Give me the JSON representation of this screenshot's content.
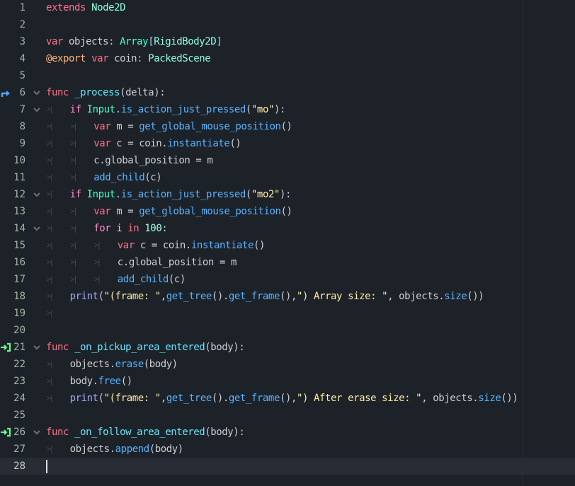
{
  "editor": {
    "current_line": 28,
    "colors": {
      "background": "#1d2229",
      "current_line": "#272c35",
      "keyword": "#ff7085",
      "type": "#42ffc2",
      "string": "#ffeda1"
    },
    "lines": [
      {
        "n": "1",
        "indent": 0,
        "tokens": [
          [
            "extends",
            "kw"
          ],
          [
            " ",
            "txt"
          ],
          [
            "Node2D",
            "type2"
          ]
        ]
      },
      {
        "n": "2",
        "indent": 0,
        "tokens": []
      },
      {
        "n": "3",
        "indent": 0,
        "tokens": [
          [
            "var",
            "kw"
          ],
          [
            " objects",
            "txt"
          ],
          [
            ": ",
            "sym"
          ],
          [
            "Array",
            "type"
          ],
          [
            "[",
            "sym"
          ],
          [
            "RigidBody2D",
            "type2"
          ],
          [
            "]",
            "sym"
          ]
        ]
      },
      {
        "n": "4",
        "indent": 0,
        "tokens": [
          [
            "@export",
            "ann"
          ],
          [
            " ",
            "txt"
          ],
          [
            "var",
            "kw"
          ],
          [
            " coin",
            "txt"
          ],
          [
            ": ",
            "sym"
          ],
          [
            "PackedScene",
            "type2"
          ]
        ]
      },
      {
        "n": "5",
        "indent": 0,
        "tokens": []
      },
      {
        "n": "6",
        "indent": 0,
        "fold": true,
        "gutter": "override-icon",
        "tokens": [
          [
            "func",
            "kw"
          ],
          [
            " ",
            "txt"
          ],
          [
            "_process",
            "fn"
          ],
          [
            "(delta):",
            "txt"
          ]
        ]
      },
      {
        "n": "7",
        "indent": 1,
        "fold": true,
        "tokens": [
          [
            "if",
            "ctl"
          ],
          [
            " ",
            "txt"
          ],
          [
            "Input",
            "type"
          ],
          [
            ".",
            "sym"
          ],
          [
            "is_action_just_pressed",
            "call"
          ],
          [
            "(",
            "txt"
          ],
          [
            "\"mo\"",
            "str"
          ],
          [
            "):",
            "txt"
          ]
        ]
      },
      {
        "n": "8",
        "indent": 2,
        "tokens": [
          [
            "var",
            "kw"
          ],
          [
            " m = ",
            "txt"
          ],
          [
            "get_global_mouse_position",
            "call"
          ],
          [
            "()",
            "txt"
          ]
        ]
      },
      {
        "n": "9",
        "indent": 2,
        "tokens": [
          [
            "var",
            "kw"
          ],
          [
            " c = coin.",
            "txt"
          ],
          [
            "instantiate",
            "call"
          ],
          [
            "()",
            "txt"
          ]
        ]
      },
      {
        "n": "10",
        "indent": 2,
        "tokens": [
          [
            "c.global_position = m",
            "txt"
          ]
        ]
      },
      {
        "n": "11",
        "indent": 2,
        "tokens": [
          [
            "add_child",
            "call"
          ],
          [
            "(c)",
            "txt"
          ]
        ]
      },
      {
        "n": "12",
        "indent": 1,
        "fold": true,
        "tokens": [
          [
            "if",
            "ctl"
          ],
          [
            " ",
            "txt"
          ],
          [
            "Input",
            "type"
          ],
          [
            ".",
            "sym"
          ],
          [
            "is_action_just_pressed",
            "call"
          ],
          [
            "(",
            "txt"
          ],
          [
            "\"mo2\"",
            "str"
          ],
          [
            "):",
            "txt"
          ]
        ]
      },
      {
        "n": "13",
        "indent": 2,
        "tokens": [
          [
            "var",
            "kw"
          ],
          [
            " m = ",
            "txt"
          ],
          [
            "get_global_mouse_position",
            "call"
          ],
          [
            "()",
            "txt"
          ]
        ]
      },
      {
        "n": "14",
        "indent": 2,
        "fold": true,
        "tokens": [
          [
            "for",
            "ctl"
          ],
          [
            " i ",
            "txt"
          ],
          [
            "in",
            "kw"
          ],
          [
            " ",
            "txt"
          ],
          [
            "100",
            "num-lit"
          ],
          [
            ":",
            "txt"
          ]
        ]
      },
      {
        "n": "15",
        "indent": 3,
        "tokens": [
          [
            "var",
            "kw"
          ],
          [
            " c = coin.",
            "txt"
          ],
          [
            "instantiate",
            "call"
          ],
          [
            "()",
            "txt"
          ]
        ]
      },
      {
        "n": "16",
        "indent": 3,
        "tokens": [
          [
            "c.global_position = m",
            "txt"
          ]
        ]
      },
      {
        "n": "17",
        "indent": 3,
        "tokens": [
          [
            "add_child",
            "call"
          ],
          [
            "(c)",
            "txt"
          ]
        ]
      },
      {
        "n": "18",
        "indent": 1,
        "tokens": [
          [
            "print",
            "builtin"
          ],
          [
            "(",
            "txt"
          ],
          [
            "\"(frame: \"",
            "str"
          ],
          [
            ",",
            "txt"
          ],
          [
            "get_tree",
            "call"
          ],
          [
            "().",
            "txt"
          ],
          [
            "get_frame",
            "call"
          ],
          [
            "(),",
            "txt"
          ],
          [
            "\") Array size: \"",
            "str"
          ],
          [
            ", objects.",
            "txt"
          ],
          [
            "size",
            "call"
          ],
          [
            "())",
            "txt"
          ]
        ]
      },
      {
        "n": "19",
        "indent": 1,
        "tokens": []
      },
      {
        "n": "20",
        "indent": 0,
        "tokens": []
      },
      {
        "n": "21",
        "indent": 0,
        "fold": true,
        "gutter": "signal-connected-icon",
        "tokens": [
          [
            "func",
            "kw"
          ],
          [
            " ",
            "txt"
          ],
          [
            "_on_pickup_area_entered",
            "fn"
          ],
          [
            "(body):",
            "txt"
          ]
        ]
      },
      {
        "n": "22",
        "indent": 1,
        "tokens": [
          [
            "objects.",
            "txt"
          ],
          [
            "erase",
            "call"
          ],
          [
            "(body)",
            "txt"
          ]
        ]
      },
      {
        "n": "23",
        "indent": 1,
        "tokens": [
          [
            "body.",
            "txt"
          ],
          [
            "free",
            "call"
          ],
          [
            "()",
            "txt"
          ]
        ]
      },
      {
        "n": "24",
        "indent": 1,
        "tokens": [
          [
            "print",
            "builtin"
          ],
          [
            "(",
            "txt"
          ],
          [
            "\"(frame: \"",
            "str"
          ],
          [
            ",",
            "txt"
          ],
          [
            "get_tree",
            "call"
          ],
          [
            "().",
            "txt"
          ],
          [
            "get_frame",
            "call"
          ],
          [
            "(),",
            "txt"
          ],
          [
            "\") After erase size: \"",
            "str"
          ],
          [
            ", objects.",
            "txt"
          ],
          [
            "size",
            "call"
          ],
          [
            "())",
            "txt"
          ]
        ]
      },
      {
        "n": "25",
        "indent": 0,
        "tokens": []
      },
      {
        "n": "26",
        "indent": 0,
        "fold": true,
        "gutter": "signal-connected-icon",
        "tokens": [
          [
            "func",
            "kw"
          ],
          [
            " ",
            "txt"
          ],
          [
            "_on_follow_area_entered",
            "fn"
          ],
          [
            "(body):",
            "txt"
          ]
        ]
      },
      {
        "n": "27",
        "indent": 1,
        "tokens": [
          [
            "objects.",
            "txt"
          ],
          [
            "append",
            "call"
          ],
          [
            "(body)",
            "txt"
          ]
        ]
      },
      {
        "n": "28",
        "indent": 0,
        "tokens": []
      }
    ]
  }
}
